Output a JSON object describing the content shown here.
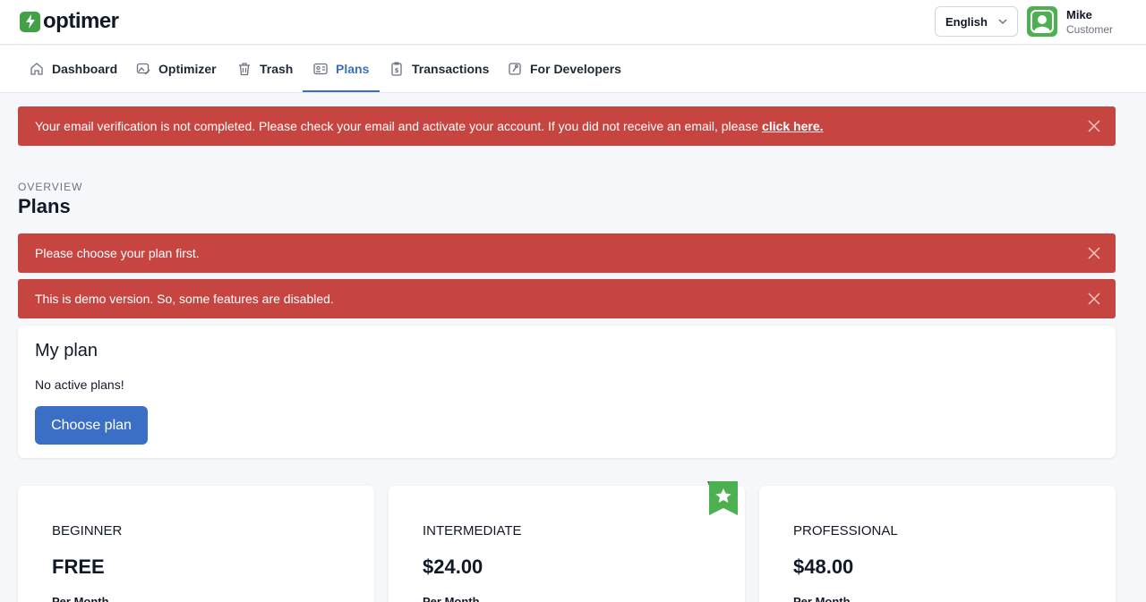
{
  "header": {
    "logo_text": "optimer",
    "language": "English",
    "user": {
      "name": "Mike",
      "role": "Customer"
    }
  },
  "nav": {
    "items": [
      {
        "label": "Dashboard",
        "icon": "home-icon"
      },
      {
        "label": "Optimizer",
        "icon": "image-edit-icon"
      },
      {
        "label": "Trash",
        "icon": "trash-icon"
      },
      {
        "label": "Plans",
        "icon": "id-card-icon",
        "active": true
      },
      {
        "label": "Transactions",
        "icon": "receipt-icon"
      },
      {
        "label": "For Developers",
        "icon": "code-file-icon"
      }
    ]
  },
  "alerts": {
    "verify": {
      "text": "Your email verification is not completed. Please check your email and activate your account. If you did not receive an email, please",
      "link": "click here."
    },
    "choose_plan": "Please choose your plan first.",
    "demo": "This is demo version. So, some features are disabled."
  },
  "page": {
    "overview": "OVERVIEW",
    "title": "Plans"
  },
  "my_plan": {
    "title": "My plan",
    "status": "No active plans!",
    "button": "Choose plan"
  },
  "plans": [
    {
      "name": "BEGINNER",
      "price": "FREE",
      "period": "Per Month"
    },
    {
      "name": "INTERMEDIATE",
      "price": "$24.00",
      "period": "Per Month",
      "featured": true
    },
    {
      "name": "PROFESSIONAL",
      "price": "$48.00",
      "period": "Per Month"
    }
  ],
  "colors": {
    "accent": "#3b6fc6",
    "danger": "#c64541",
    "brand": "#43a047"
  }
}
